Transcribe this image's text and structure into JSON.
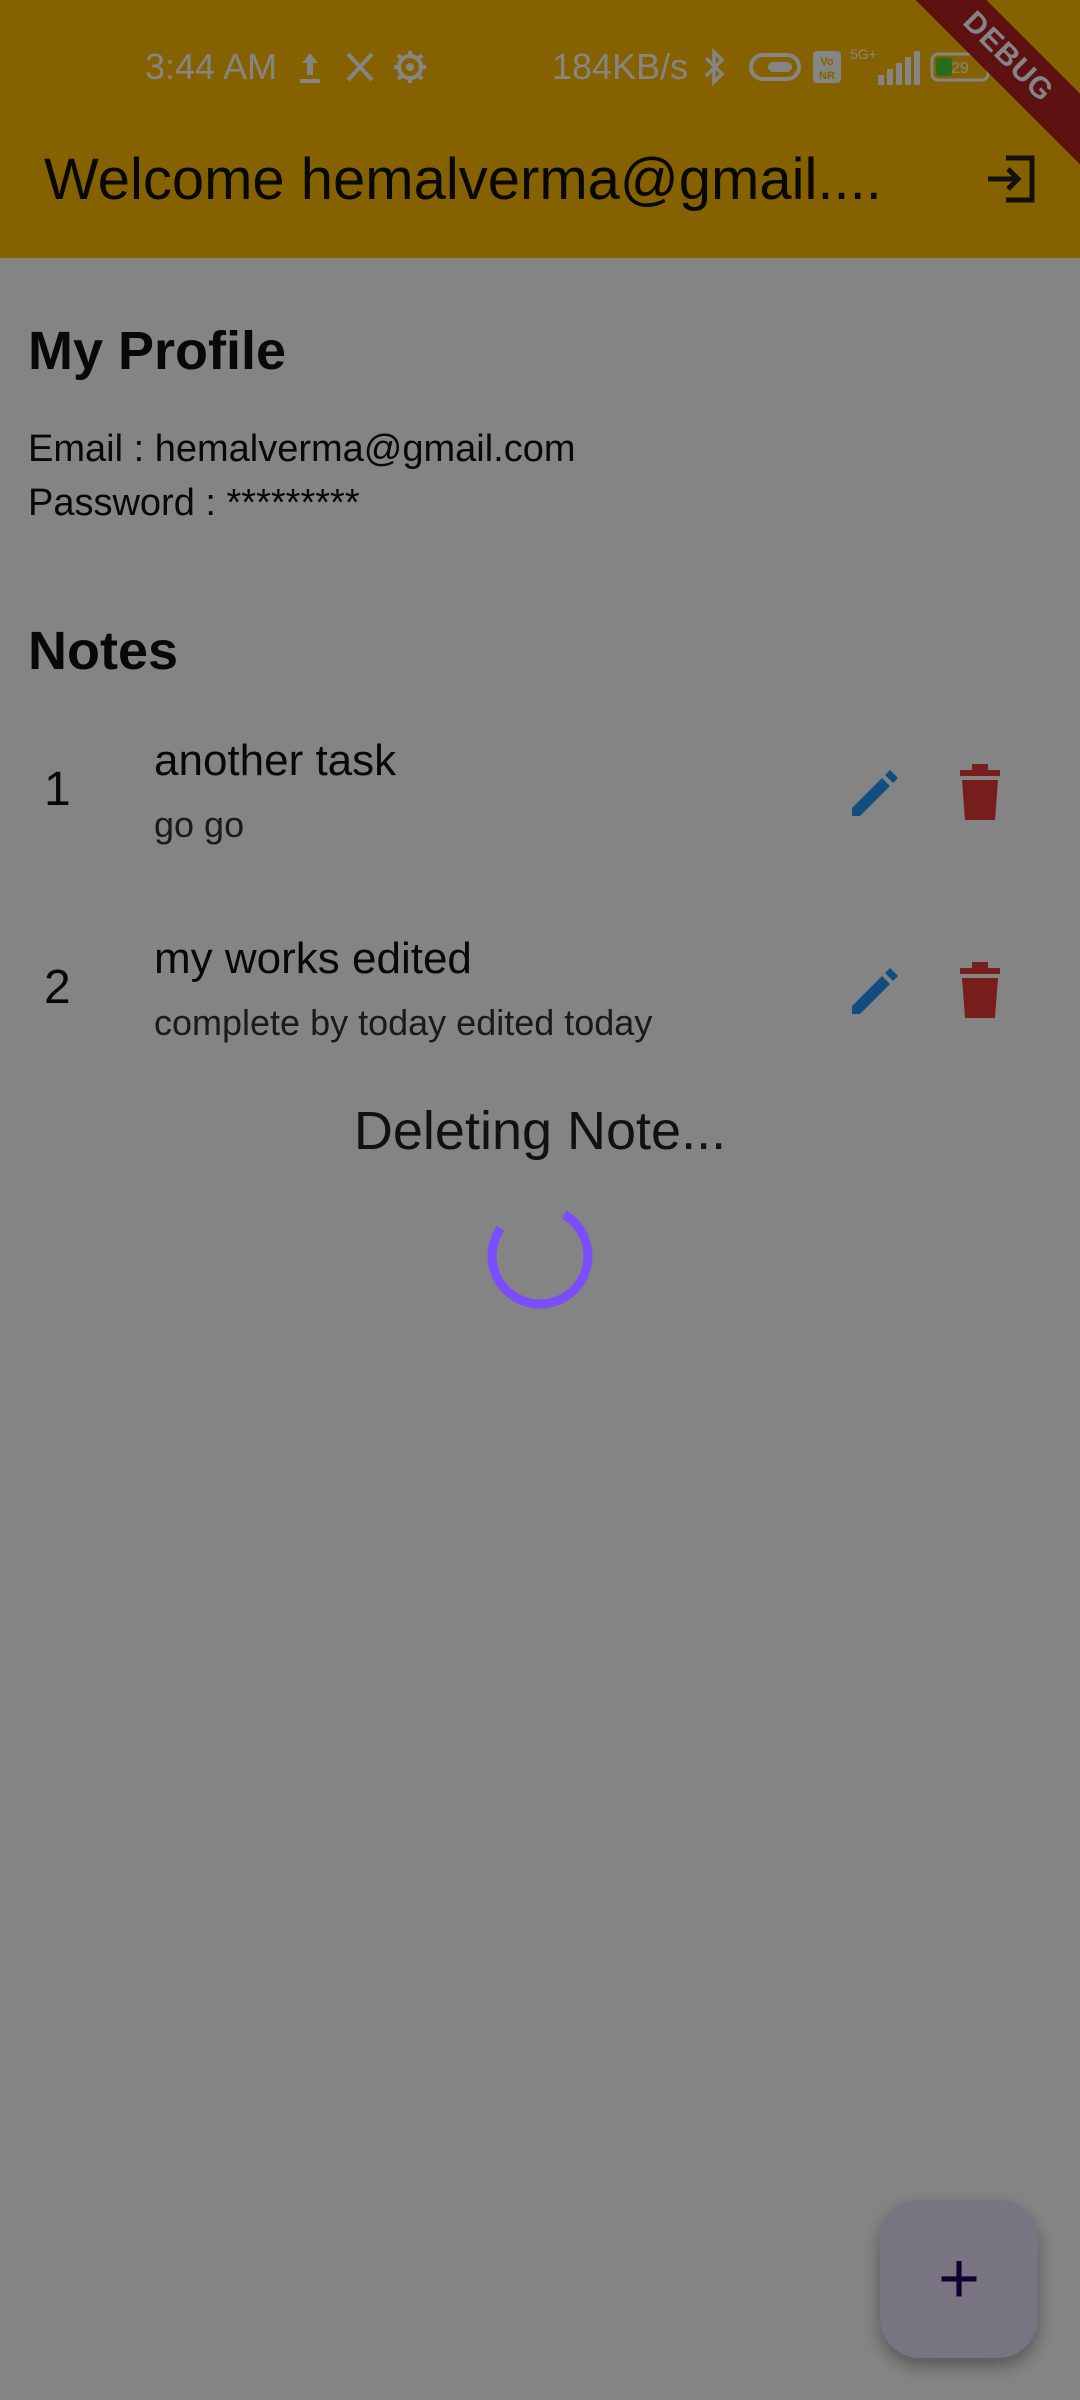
{
  "status_bar": {
    "time": "3:44 AM",
    "net_speed": "184KB/s",
    "network": "5G+",
    "battery": "29",
    "icons": [
      "upload-icon",
      "x-logo-icon",
      "settings-gear-icon",
      "bluetooth-icon",
      "link-icon",
      "volte-icon",
      "signal-icon",
      "battery-icon"
    ]
  },
  "app_bar": {
    "title": "Welcome hemalverma@gmail....",
    "action_icon": "logout-icon",
    "background": "#ffbb00"
  },
  "debug_banner": "DEBUG",
  "profile": {
    "heading": "My Profile",
    "email_line": "Email : hemalverma@gmail.com",
    "password_line": "Password : *********"
  },
  "notes": {
    "heading": "Notes",
    "items": [
      {
        "number": "1",
        "title": "another task",
        "subtitle": "go go"
      },
      {
        "number": "2",
        "title": "my works edited",
        "subtitle": "complete by today edited today"
      }
    ],
    "edit_color": "#2196f3",
    "delete_color": "#e53935"
  },
  "dialog": {
    "message": "Deleting Note...",
    "spinner_color": "#7c4dff"
  },
  "fab": {
    "label": "+"
  }
}
